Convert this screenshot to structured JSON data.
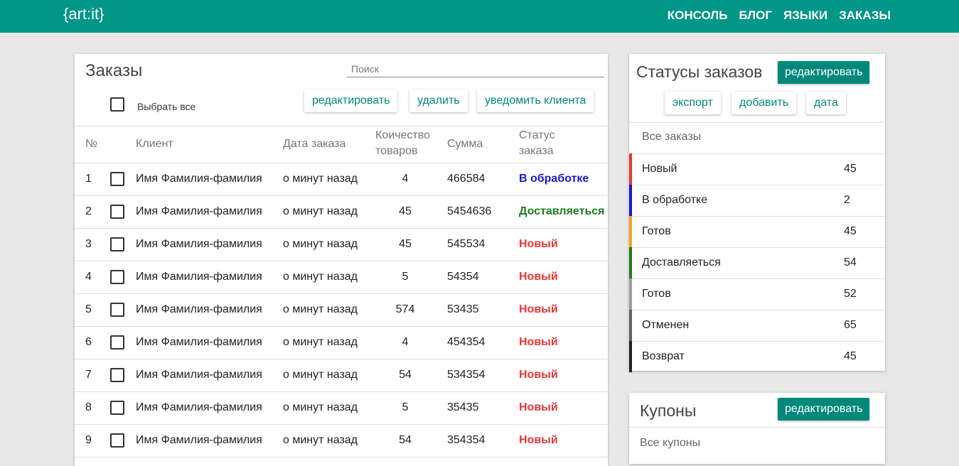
{
  "navbar": {
    "logo": "{art:it}",
    "links": [
      "КОНСОЛЬ",
      "БЛОГ",
      "ЯЗЫКИ",
      "ЗАКАЗЫ"
    ]
  },
  "orders": {
    "title": "Заказы",
    "search_placeholder": "Поиск",
    "select_all_label": "Выбрать все",
    "buttons": {
      "edit": "редактировать",
      "delete": "удалить",
      "notify": "уведомить клиента"
    },
    "columns": {
      "number": "№",
      "client": "Клиент",
      "date": "Дата заказа",
      "quantity": [
        "Коичество",
        "товаров"
      ],
      "sum": "Сумма",
      "status": [
        "Статус",
        "заказа"
      ]
    },
    "rows": [
      {
        "n": "1",
        "client": "Имя Фамилия-фамилия",
        "date": "о минут назад",
        "qty": "4",
        "sum": "466584",
        "status": "В обработке",
        "status_color": "#1a1acc"
      },
      {
        "n": "2",
        "client": "Имя Фамилия-фамилия",
        "date": "о минут назад",
        "qty": "45",
        "sum": "5454636",
        "status": "Доставляеться",
        "status_color": "#1b7d1b"
      },
      {
        "n": "3",
        "client": "Имя Фамилия-фамилия",
        "date": "о минут назад",
        "qty": "45",
        "sum": "545534",
        "status": "Новый",
        "status_color": "#e53935"
      },
      {
        "n": "4",
        "client": "Имя Фамилия-фамилия",
        "date": "о минут назад",
        "qty": "5",
        "sum": "54354",
        "status": "Новый",
        "status_color": "#e53935"
      },
      {
        "n": "5",
        "client": "Имя Фамилия-фамилия",
        "date": "о минут назад",
        "qty": "574",
        "sum": "53435",
        "status": "Новый",
        "status_color": "#e53935"
      },
      {
        "n": "6",
        "client": "Имя Фамилия-фамилия",
        "date": "о минут назад",
        "qty": "4",
        "sum": "454354",
        "status": "Новый",
        "status_color": "#e53935"
      },
      {
        "n": "7",
        "client": "Имя Фамилия-фамилия",
        "date": "о минут назад",
        "qty": "54",
        "sum": "534354",
        "status": "Новый",
        "status_color": "#e53935"
      },
      {
        "n": "8",
        "client": "Имя Фамилия-фамилия",
        "date": "о минут назад",
        "qty": "5",
        "sum": "35435",
        "status": "Новый",
        "status_color": "#e53935"
      },
      {
        "n": "9",
        "client": "Имя Фамилия-фамилия",
        "date": "о минут назад",
        "qty": "54",
        "sum": "354354",
        "status": "Новый",
        "status_color": "#e53935"
      }
    ]
  },
  "statuses": {
    "title": "Статусы заказов",
    "edit_button": "редактировать",
    "buttons": {
      "export": "экспорт",
      "add": "добавить",
      "date": "дата"
    },
    "all_label": "Все заказы",
    "items": [
      {
        "label": "Новый",
        "count": "45",
        "color": "#e53935"
      },
      {
        "label": "В обработке",
        "count": "2",
        "color": "#1a1acc"
      },
      {
        "label": "Готов",
        "count": "45",
        "color": "#f5a623"
      },
      {
        "label": "Доставляеться",
        "count": "54",
        "color": "#1b7d1b"
      },
      {
        "label": "Готов",
        "count": "52",
        "color": "#9e9e9e"
      },
      {
        "label": "Отменен",
        "count": "65",
        "color": "#616161"
      },
      {
        "label": "Возврат",
        "count": "45",
        "color": "#212121"
      }
    ]
  },
  "coupons": {
    "title": "Купоны",
    "edit_button": "редактировать",
    "all_label": "Все купоны"
  }
}
